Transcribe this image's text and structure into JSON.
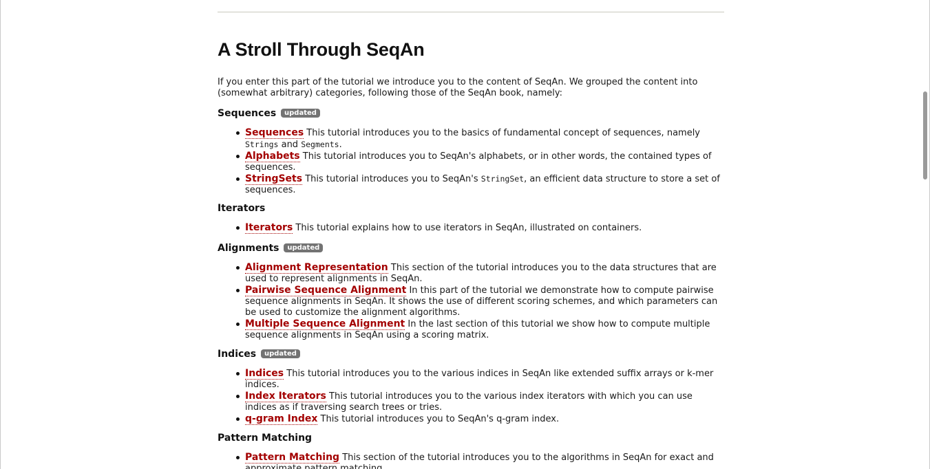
{
  "page": {
    "title": "A Stroll Through SeqAn",
    "intro": "If you enter this part of the tutorial we introduce you to the content of SeqAn. We grouped the content into (somewhat arbitrary) categories, following those of the SeqAn book, namely:"
  },
  "badge_label": "updated",
  "sections": {
    "sequences": {
      "heading": "Sequences",
      "items": [
        {
          "link": "Sequences",
          "pre": " This tutorial introduces you to the basics of fundamental concept of sequences, namely ",
          "code1": "Strings",
          "mid": " and ",
          "code2": "Segments",
          "post": "."
        },
        {
          "link": "Alphabets",
          "text": " This tutorial introduces you to SeqAn's alphabets, or in other words, the contained types of sequences."
        },
        {
          "link": "StringSets",
          "pre": " This tutorial introduces you to SeqAn's ",
          "code1": "StringSet",
          "post": ", an efficient data structure to store a set of sequences."
        }
      ]
    },
    "iterators": {
      "heading": "Iterators",
      "items": [
        {
          "link": "Iterators",
          "text": " This tutorial explains how to use iterators in SeqAn, illustrated on containers."
        }
      ]
    },
    "alignments": {
      "heading": "Alignments",
      "items": [
        {
          "link": "Alignment Representation",
          "text": " This section of the tutorial introduces you to the data structures that are used to represent alignments in SeqAn."
        },
        {
          "link": "Pairwise Sequence Alignment",
          "text": " In this part of the tutorial we demonstrate how to compute pairwise sequence alignments in SeqAn. It shows the use of different scoring schemes, and which parameters can be used to customize the alignment algorithms."
        },
        {
          "link": "Multiple Sequence Alignment",
          "text": " In the last section of this tutorial we show how to compute multiple sequence alignments in SeqAn using a scoring matrix."
        }
      ]
    },
    "indices": {
      "heading": "Indices",
      "items": [
        {
          "link": "Indices",
          "text": " This tutorial introduces you to the various indices in SeqAn like extended suffix arrays or k-mer indices."
        },
        {
          "link": "Index Iterators",
          "text": " This tutorial introduces you to the various index iterators with which you can use indices as if traversing search trees or tries."
        },
        {
          "link": "q-gram Index",
          "text": " This tutorial introduces you to SeqAn's q-gram index."
        }
      ]
    },
    "pattern_matching": {
      "heading": "Pattern Matching",
      "items": [
        {
          "link": "Pattern Matching",
          "text": " This section of the tutorial introduces you to the algorithms in SeqAn for exact and approximate pattern matching."
        }
      ]
    }
  },
  "colors": {
    "link": "#a30000",
    "badge": "#737373",
    "rule": "#c9c9bd"
  }
}
